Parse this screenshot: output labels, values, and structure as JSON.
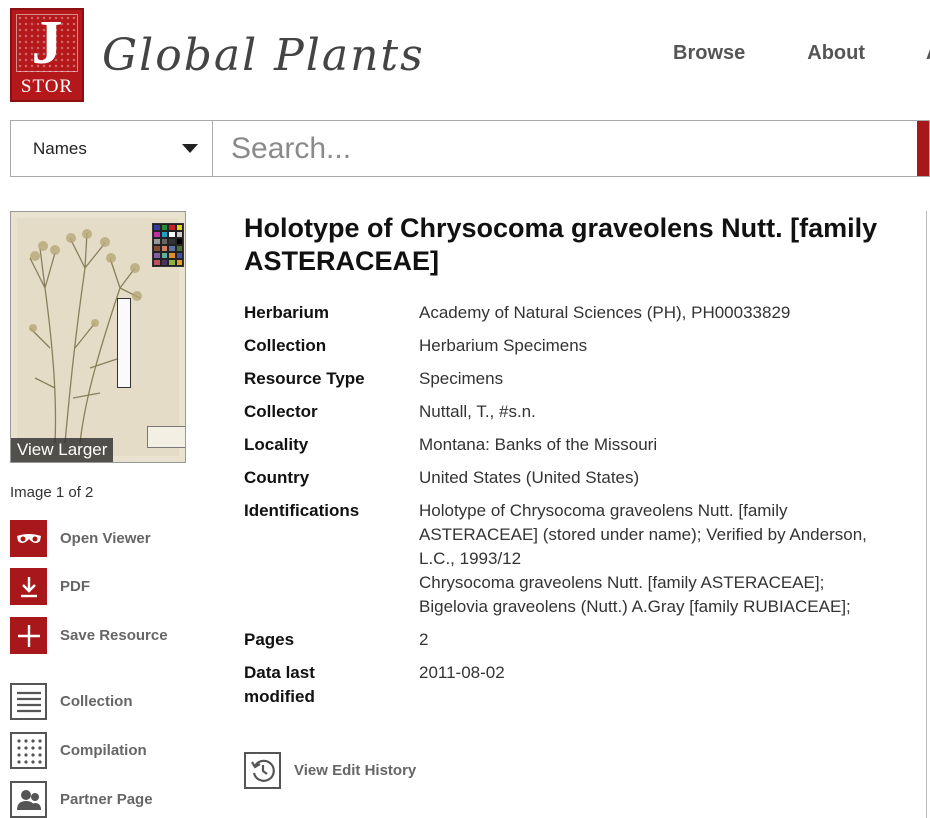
{
  "logo": {
    "letter": "J",
    "text": "STOR"
  },
  "brand": {
    "title": "Global Plants"
  },
  "nav": {
    "items": [
      "Browse",
      "About"
    ],
    "edge": "A"
  },
  "search": {
    "select_value": "Names",
    "placeholder": "Search..."
  },
  "thumbnail": {
    "overlay_label": "View Larger"
  },
  "image_count": "Image 1 of 2",
  "actions": [
    {
      "label": "Open Viewer",
      "icon": "glasses-icon"
    },
    {
      "label": "PDF",
      "icon": "download-icon"
    },
    {
      "label": "Save Resource",
      "icon": "plus-icon"
    },
    {
      "label": "Collection",
      "icon": "list-icon"
    },
    {
      "label": "Compilation",
      "icon": "grid-icon"
    },
    {
      "label": "Partner Page",
      "icon": "people-icon"
    }
  ],
  "record": {
    "title": "Holotype of Chrysocoma graveolens Nutt. [family ASTERACEAE]",
    "fields": [
      {
        "key": "Herbarium",
        "value": "Academy of Natural Sciences (PH), PH00033829"
      },
      {
        "key": "Collection",
        "value": "Herbarium Specimens"
      },
      {
        "key": "Resource Type",
        "value": "Specimens"
      },
      {
        "key": "Collector",
        "value": "Nuttall, T., #s.n."
      },
      {
        "key": "Locality",
        "value": "Montana: Banks of the Missouri"
      },
      {
        "key": "Country",
        "value": "United States (United States)"
      },
      {
        "key": "Identifications",
        "value": "Holotype of Chrysocoma graveolens Nutt. [family ASTERACEAE] (stored under name); Verified by Anderson, L.C., 1993/12"
      },
      {
        "key": "Identifications_2",
        "value": "Chrysocoma graveolens Nutt. [family ASTERACEAE];"
      },
      {
        "key": "Identifications_3",
        "value": "Bigelovia graveolens (Nutt.) A.Gray [family RUBIACEAE];"
      },
      {
        "key": "Pages",
        "value": "2"
      },
      {
        "key": "Data last modified",
        "value": "2011-08-02"
      }
    ],
    "edit_history_label": "View Edit History"
  },
  "colors": {
    "brand_red": "#a8171a",
    "text": "#222222",
    "muted": "#666666"
  }
}
